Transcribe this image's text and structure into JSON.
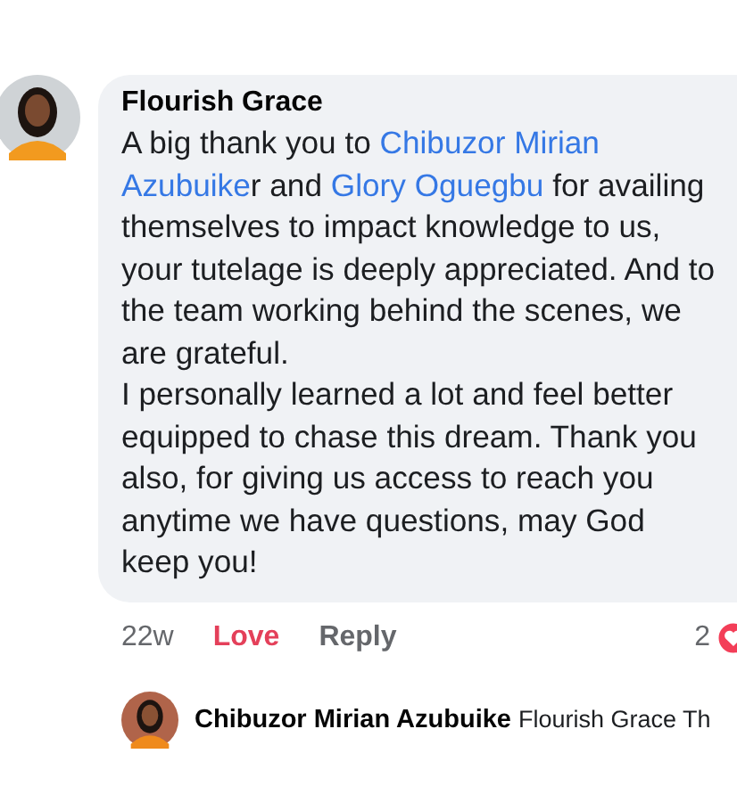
{
  "comment": {
    "author": "Flourish Grace",
    "paragraphs": [
      [
        {
          "kind": "plain",
          "text": "A big thank you to "
        },
        {
          "kind": "mention",
          "text": "Chibuzor Mirian"
        },
        {
          "kind": "mention",
          "text": " Azubuike"
        },
        {
          "kind": "plain",
          "text": "r and "
        },
        {
          "kind": "mention",
          "text": "Glory Oguegbu"
        },
        {
          "kind": "plain",
          "text": " for availing themselves to impact knowledge to us, your tutelage is deeply appreciated. And to the team working behind the scenes, we are grateful."
        }
      ],
      [
        {
          "kind": "plain",
          "text": "I personally learned a lot and feel better equipped to chase this dream. Thank you also, for giving us access to reach you anytime we have questions, may God keep you!"
        }
      ]
    ],
    "time": "22w",
    "reaction_label": "Love",
    "reacted": true,
    "reply_label": "Reply",
    "reaction_count": "2"
  },
  "reply": {
    "author": "Chibuzor Mirian Azubuike",
    "text": "Flourish Grace Th"
  }
}
